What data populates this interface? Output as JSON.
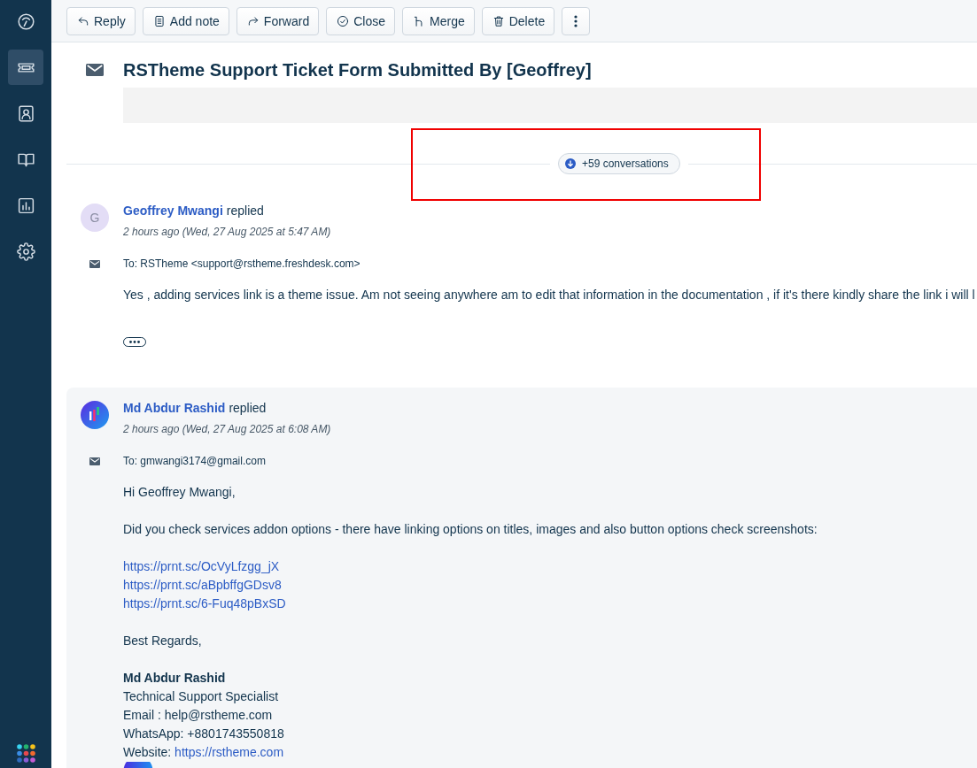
{
  "sidebar": {
    "items": [
      {
        "selected": false
      },
      {
        "selected": true
      },
      {
        "selected": false
      },
      {
        "selected": false
      },
      {
        "selected": false
      },
      {
        "selected": false
      }
    ]
  },
  "toolbar": {
    "buttons": [
      "Reply",
      "Add note",
      "Forward",
      "Close",
      "Merge",
      "Delete"
    ]
  },
  "ticket": {
    "title": "RSTheme Support Ticket Form Submitted By [Geoffrey]",
    "conversations_toggle": "+59 conversations"
  },
  "messages": [
    {
      "kind": "customer",
      "author": "Geoffrey Mwangi",
      "action": "replied",
      "time": "2 hours ago (Wed, 27 Aug 2025 at 5:47 AM)",
      "avatar": {
        "kind": "initial",
        "text": "G"
      },
      "to": "To: RSTheme <support@rstheme.freshdesk.com>",
      "body": [
        [
          {
            "kind": "text",
            "text": "Yes , adding services link is a theme issue. Am not seeing anywhere am to edit that information in the documentation , if it's there kindly share the link i will l"
          }
        ]
      ],
      "quoted_text_toggle": true,
      "signature_logo": false
    },
    {
      "kind": "agent",
      "author": "Md Abdur Rashid",
      "action": "replied",
      "time": "2 hours ago (Wed, 27 Aug 2025 at 6:08 AM)",
      "avatar": {
        "kind": "logo"
      },
      "to": "To: gmwangi3174@gmail.com",
      "body": [
        [
          {
            "kind": "text",
            "text": "Hi Geoffrey Mwangi,"
          }
        ],
        [
          {
            "kind": "text",
            "text": "Did you check services addon options - there have linking options on titles, images and also button options check screenshots:"
          }
        ],
        [
          {
            "kind": "link",
            "text": "https://prnt.sc/OcVyLfzgg_jX"
          },
          {
            "kind": "link",
            "text": "https://prnt.sc/aBpbffgGDsv8"
          },
          {
            "kind": "link",
            "text": "https://prnt.sc/6-Fuq48pBxSD"
          }
        ],
        [
          {
            "kind": "text",
            "text": "Best Regards,"
          }
        ],
        [
          {
            "kind": "bold",
            "text": "Md Abdur Rashid"
          },
          {
            "kind": "text",
            "text": "Technical Support Specialist"
          },
          {
            "kind": "text",
            "text": "Email : help@rstheme.com"
          },
          {
            "kind": "text",
            "text": "WhatsApp: +8801743550818"
          },
          {
            "kind": "text_with_link",
            "text": "Website:",
            "link": "https://rstheme.com"
          }
        ]
      ],
      "quoted_text_toggle": false,
      "signature_logo": true
    }
  ]
}
